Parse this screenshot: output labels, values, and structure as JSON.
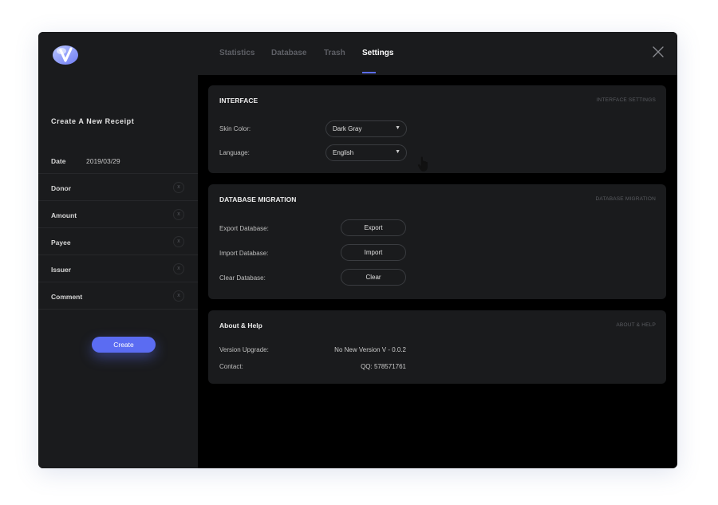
{
  "sidebar": {
    "title": "Create A New Receipt",
    "fields": [
      {
        "label": "Date",
        "value": "2019/03/29"
      },
      {
        "label": "Donor",
        "value": ""
      },
      {
        "label": "Amount",
        "value": ""
      },
      {
        "label": "Payee",
        "value": ""
      },
      {
        "label": "Issuer",
        "value": ""
      },
      {
        "label": "Comment",
        "value": ""
      }
    ],
    "clear_glyph": "x",
    "create_label": "Create"
  },
  "nav": {
    "tabs": [
      "Statistics",
      "Database",
      "Trash",
      "Settings"
    ],
    "active": "Settings"
  },
  "interface": {
    "title": "INTERFACE",
    "tag": "INTERFACE SETTINGS",
    "skin_label": "Skin Color:",
    "skin_value": "Dark Gray",
    "language_label": "Language:",
    "language_value": "English"
  },
  "migration": {
    "title": "DATABASE MIGRATION",
    "tag": "DATABASE MIGRATION",
    "export_label": "Export Database:",
    "export_button": "Export",
    "import_label": "Import Database:",
    "import_button": "Import",
    "clear_label": "Clear Database:",
    "clear_button": "Clear"
  },
  "about": {
    "title": "About & Help",
    "tag": "ABOUT & HELP",
    "version_label": "Version Upgrade:",
    "version_value": "No New Version V - 0.0.2",
    "contact_label": "Contact:",
    "contact_value": "QQ: 578571761"
  },
  "icons": {
    "logo": "app-logo-icon",
    "close": "close-icon",
    "dropdown": "chevron-down-icon",
    "cursor": "hand-pointer-icon"
  },
  "colors": {
    "accent": "#5b6cf2",
    "panel": "#1a1b1d",
    "background": "#000000"
  }
}
